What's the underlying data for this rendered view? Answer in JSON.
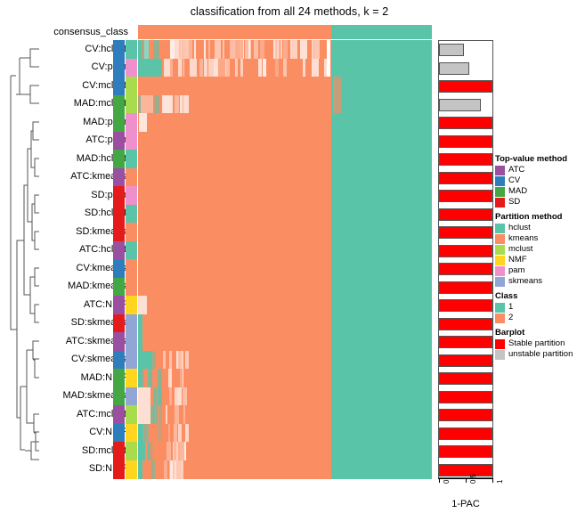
{
  "title": "classification from all 24 methods, k = 2",
  "consensus": {
    "label": "consensus_class",
    "split_fraction": 0.658,
    "left_class": "2",
    "right_class": "1"
  },
  "colors": {
    "ATC": "#9b4fa0",
    "CV": "#2e7dbd",
    "MAD": "#43a843",
    "SD": "#e51b1b",
    "hclust": "#5ac4a8",
    "kmeans": "#fb8d63",
    "mclust": "#a8dc4d",
    "NMF": "#ffd520",
    "pam": "#ef90cd",
    "skmeans": "#91a6d4",
    "class1": "#5ac4a8",
    "class2": "#fb8d63",
    "stable": "#ff0000",
    "unstable": "#c4c4c4"
  },
  "rows": [
    {
      "label": "CV:hclust",
      "top_value": "CV",
      "partition": "hclust",
      "pac": 0.46,
      "stable": false
    },
    {
      "label": "CV:pam",
      "top_value": "CV",
      "partition": "pam",
      "pac": 0.57,
      "stable": false
    },
    {
      "label": "CV:mclust",
      "top_value": "CV",
      "partition": "mclust",
      "pac": 1.0,
      "stable": true
    },
    {
      "label": "MAD:mclust",
      "top_value": "MAD",
      "partition": "mclust",
      "pac": 0.79,
      "stable": false
    },
    {
      "label": "MAD:pam",
      "top_value": "MAD",
      "partition": "pam",
      "pac": 1.0,
      "stable": true
    },
    {
      "label": "ATC:pam",
      "top_value": "ATC",
      "partition": "pam",
      "pac": 1.0,
      "stable": true
    },
    {
      "label": "MAD:hclust",
      "top_value": "MAD",
      "partition": "hclust",
      "pac": 1.0,
      "stable": true
    },
    {
      "label": "ATC:kmeans",
      "top_value": "ATC",
      "partition": "kmeans",
      "pac": 1.0,
      "stable": true
    },
    {
      "label": "SD:pam",
      "top_value": "SD",
      "partition": "pam",
      "pac": 1.0,
      "stable": true
    },
    {
      "label": "SD:hclust",
      "top_value": "SD",
      "partition": "hclust",
      "pac": 1.0,
      "stable": true
    },
    {
      "label": "SD:kmeans",
      "top_value": "SD",
      "partition": "kmeans",
      "pac": 1.0,
      "stable": true
    },
    {
      "label": "ATC:hclust",
      "top_value": "ATC",
      "partition": "hclust",
      "pac": 1.0,
      "stable": true
    },
    {
      "label": "CV:kmeans",
      "top_value": "CV",
      "partition": "kmeans",
      "pac": 1.0,
      "stable": true
    },
    {
      "label": "MAD:kmeans",
      "top_value": "MAD",
      "partition": "kmeans",
      "pac": 1.0,
      "stable": true
    },
    {
      "label": "ATC:NMF",
      "top_value": "ATC",
      "partition": "NMF",
      "pac": 1.0,
      "stable": true
    },
    {
      "label": "SD:skmeans",
      "top_value": "SD",
      "partition": "skmeans",
      "pac": 1.0,
      "stable": true
    },
    {
      "label": "ATC:skmeans",
      "top_value": "ATC",
      "partition": "skmeans",
      "pac": 1.0,
      "stable": true
    },
    {
      "label": "CV:skmeans",
      "top_value": "CV",
      "partition": "skmeans",
      "pac": 1.0,
      "stable": true
    },
    {
      "label": "MAD:NMF",
      "top_value": "MAD",
      "partition": "NMF",
      "pac": 1.0,
      "stable": true
    },
    {
      "label": "MAD:skmeans",
      "top_value": "MAD",
      "partition": "skmeans",
      "pac": 1.0,
      "stable": true
    },
    {
      "label": "ATC:mclust",
      "top_value": "ATC",
      "partition": "mclust",
      "pac": 1.0,
      "stable": true
    },
    {
      "label": "CV:NMF",
      "top_value": "CV",
      "partition": "NMF",
      "pac": 1.0,
      "stable": true
    },
    {
      "label": "SD:mclust",
      "top_value": "SD",
      "partition": "mclust",
      "pac": 1.0,
      "stable": true
    },
    {
      "label": "SD:NMF",
      "top_value": "SD",
      "partition": "NMF",
      "pac": 1.0,
      "stable": true
    }
  ],
  "barplot": {
    "xlabel": "1-PAC",
    "ticks": [
      {
        "value": 0,
        "label": "0"
      },
      {
        "value": 0.5,
        "label": "0.5"
      },
      {
        "value": 1,
        "label": "1"
      }
    ]
  },
  "legend": [
    {
      "title": "Top-value method",
      "items": [
        {
          "label": "ATC",
          "color": "#9b4fa0"
        },
        {
          "label": "CV",
          "color": "#2e7dbd"
        },
        {
          "label": "MAD",
          "color": "#43a843"
        },
        {
          "label": "SD",
          "color": "#e51b1b"
        }
      ]
    },
    {
      "title": "Partition method",
      "items": [
        {
          "label": "hclust",
          "color": "#5ac4a8"
        },
        {
          "label": "kmeans",
          "color": "#fb8d63"
        },
        {
          "label": "mclust",
          "color": "#a8dc4d"
        },
        {
          "label": "NMF",
          "color": "#ffd520"
        },
        {
          "label": "pam",
          "color": "#ef90cd"
        },
        {
          "label": "skmeans",
          "color": "#91a6d4"
        }
      ]
    },
    {
      "title": "Class",
      "items": [
        {
          "label": "1",
          "color": "#5ac4a8"
        },
        {
          "label": "2",
          "color": "#fb8d63"
        }
      ]
    },
    {
      "title": "Barplot",
      "items": [
        {
          "label": "Stable partition",
          "color": "#ff0000"
        },
        {
          "label": "unstable partition",
          "color": "#c4c4c4"
        }
      ]
    }
  ],
  "chart_data": {
    "type": "heatmap",
    "title": "classification from all 24 methods, k = 2",
    "xlabel": "",
    "ylabel": "",
    "n_methods": 24,
    "k": 2,
    "row_labels": [
      "CV:hclust",
      "CV:pam",
      "CV:mclust",
      "MAD:mclust",
      "MAD:pam",
      "ATC:pam",
      "MAD:hclust",
      "ATC:kmeans",
      "SD:pam",
      "SD:hclust",
      "SD:kmeans",
      "ATC:hclust",
      "CV:kmeans",
      "MAD:kmeans",
      "ATC:NMF",
      "SD:skmeans",
      "ATC:skmeans",
      "CV:skmeans",
      "MAD:NMF",
      "MAD:skmeans",
      "ATC:mclust",
      "CV:NMF",
      "SD:mclust",
      "SD:NMF"
    ],
    "classes": [
      "1",
      "2"
    ],
    "class_colors": [
      "#5ac4a8",
      "#fb8d63"
    ],
    "consensus_split_fraction": 0.658,
    "barplot": {
      "type": "bar",
      "orientation": "horizontal",
      "xlabel": "1-PAC",
      "xlim": [
        0,
        1
      ],
      "categories": [
        "CV:hclust",
        "CV:pam",
        "CV:mclust",
        "MAD:mclust",
        "MAD:pam",
        "ATC:pam",
        "MAD:hclust",
        "ATC:kmeans",
        "SD:pam",
        "SD:hclust",
        "SD:kmeans",
        "ATC:hclust",
        "CV:kmeans",
        "MAD:kmeans",
        "ATC:NMF",
        "SD:skmeans",
        "ATC:skmeans",
        "CV:skmeans",
        "MAD:NMF",
        "MAD:skmeans",
        "ATC:mclust",
        "CV:NMF",
        "SD:mclust",
        "SD:NMF"
      ],
      "values": [
        0.46,
        0.57,
        1.0,
        0.79,
        1.0,
        1.0,
        1.0,
        1.0,
        1.0,
        1.0,
        1.0,
        1.0,
        1.0,
        1.0,
        1.0,
        1.0,
        1.0,
        1.0,
        1.0,
        1.0,
        1.0,
        1.0,
        1.0,
        1.0
      ],
      "bar_colors": [
        "#c4c4c4",
        "#c4c4c4",
        "#ff0000",
        "#c4c4c4",
        "#ff0000",
        "#ff0000",
        "#ff0000",
        "#ff0000",
        "#ff0000",
        "#ff0000",
        "#ff0000",
        "#ff0000",
        "#ff0000",
        "#ff0000",
        "#ff0000",
        "#ff0000",
        "#ff0000",
        "#ff0000",
        "#ff0000",
        "#ff0000",
        "#ff0000",
        "#ff0000",
        "#ff0000",
        "#ff0000"
      ]
    }
  }
}
